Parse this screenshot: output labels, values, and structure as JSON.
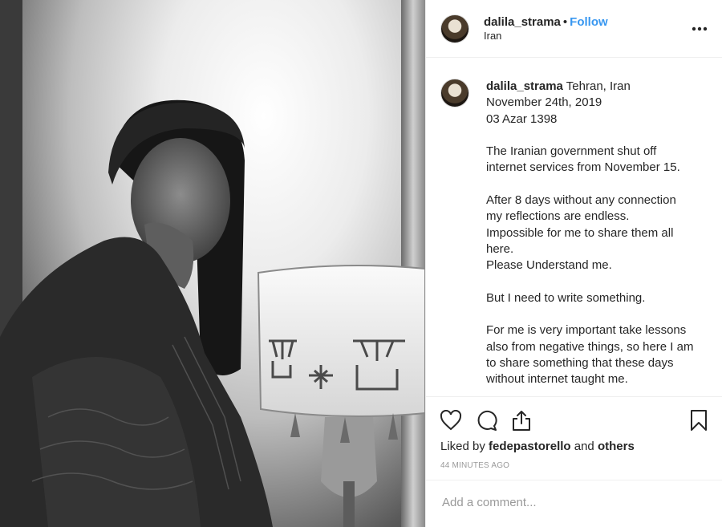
{
  "header": {
    "username": "dalila_strama",
    "separator": "•",
    "follow_label": "Follow",
    "location": "Iran"
  },
  "caption": {
    "username": "dalila_strama",
    "lines": [
      "Tehran, Iran",
      "November 24th, 2019",
      "03 Azar 1398",
      "",
      "The Iranian government shut off",
      "internet services from November 15.",
      "",
      "After 8 days without any connection",
      "my reflections are endless.",
      "Impossible for me to share them all",
      "here.",
      "Please Understand me.",
      "",
      "But I need to write something.",
      "",
      "For me is very important take lessons",
      "also from negative things, so here I am",
      "to share something that these days",
      "without internet taught me."
    ]
  },
  "actions": {
    "liked_prefix": "Liked by",
    "liked_user": "fedepastorello",
    "liked_and": "and",
    "liked_others": "others",
    "timestamp": "44 MINUTES AGO",
    "comment_placeholder": "Add a comment..."
  },
  "icons": [
    "heart-icon",
    "comment-icon",
    "share-icon",
    "bookmark-icon",
    "more-options-icon"
  ]
}
